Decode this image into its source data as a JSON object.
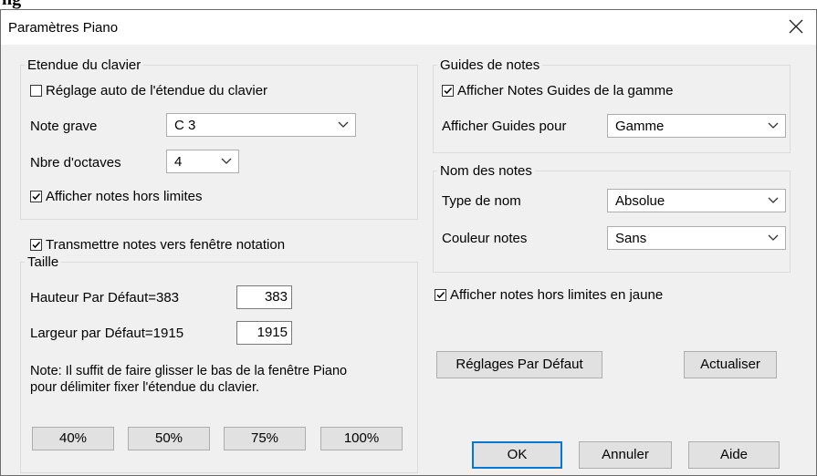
{
  "window": {
    "title": "Paramètres Piano",
    "close_icon": "close-icon"
  },
  "keyboard_range": {
    "legend": "Etendue du clavier",
    "auto_range": {
      "label": "Réglage auto de l'étendue du clavier",
      "checked": false
    },
    "low_note": {
      "label": "Note grave",
      "value": "C 3"
    },
    "octaves": {
      "label": "Nbre d'octaves",
      "value": "4"
    },
    "show_out_of_range": {
      "label": "Afficher notes hors limites",
      "checked": true
    }
  },
  "transmit_notation": {
    "label": "Transmettre notes vers fenêtre notation",
    "checked": true
  },
  "size": {
    "legend": "Taille",
    "height_label": "Hauteur Par Défaut=383",
    "height_value": "383",
    "width_label": "Largeur par Défaut=1915",
    "width_value": "1915",
    "note_line1": "Note: Il suffit de faire glisser le bas de la fenêtre Piano",
    "note_line2": "pour délimiter fixer l'étendue du clavier.",
    "zoom_buttons": [
      "40%",
      "50%",
      "75%",
      "100%"
    ]
  },
  "note_guides": {
    "legend": "Guides de notes",
    "show_scale_guides": {
      "label": "Afficher Notes Guides de la gamme",
      "checked": true
    },
    "show_guides_for": {
      "label": "Afficher Guides pour",
      "value": "Gamme"
    }
  },
  "note_names": {
    "legend": "Nom des notes",
    "name_type": {
      "label": "Type de nom",
      "value": "Absolue"
    },
    "note_color": {
      "label": "Couleur notes",
      "value": "Sans"
    }
  },
  "show_out_of_range_yellow": {
    "label": "Afficher notes hors limites en jaune",
    "checked": true
  },
  "buttons": {
    "defaults": "Réglages Par Défaut",
    "refresh": "Actualiser",
    "ok": "OK",
    "cancel": "Annuler",
    "help": "Aide"
  },
  "colors": {
    "accent": "#0078d7",
    "dialog_bg": "#f0f0f0"
  }
}
